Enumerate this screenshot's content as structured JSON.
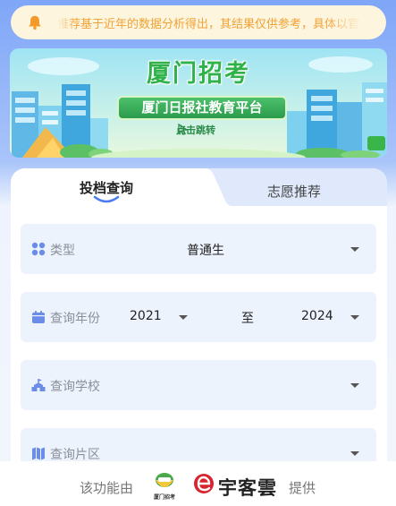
{
  "notice": {
    "icon": "bell-icon",
    "text": "推荐基于近年的数据分析得出，其结果仅供参考，具体以官方公布为准"
  },
  "banner": {
    "title": "厦门招考",
    "subtitle": "厦门日报社教育平台",
    "cta": "点击跳转"
  },
  "tabs": [
    {
      "label": "投档查询",
      "active": true
    },
    {
      "label": "志愿推荐",
      "active": false
    }
  ],
  "form": {
    "type": {
      "label": "类型",
      "value": "普通生"
    },
    "years": {
      "label": "查询年份",
      "from": "2021",
      "separator": "至",
      "to": "2024"
    },
    "school": {
      "label": "查询学校",
      "value": ""
    },
    "district": {
      "label": "查询片区",
      "value": ""
    }
  },
  "footer": {
    "prefix": "该功能由",
    "logo_caption": "厦门招考",
    "brand": "宇客雲",
    "suffix": "提供"
  },
  "colors": {
    "accent": "#4a7bf0",
    "notice_text": "#f0a236",
    "green": "#2fb24a",
    "brand_red": "#d9232e"
  }
}
